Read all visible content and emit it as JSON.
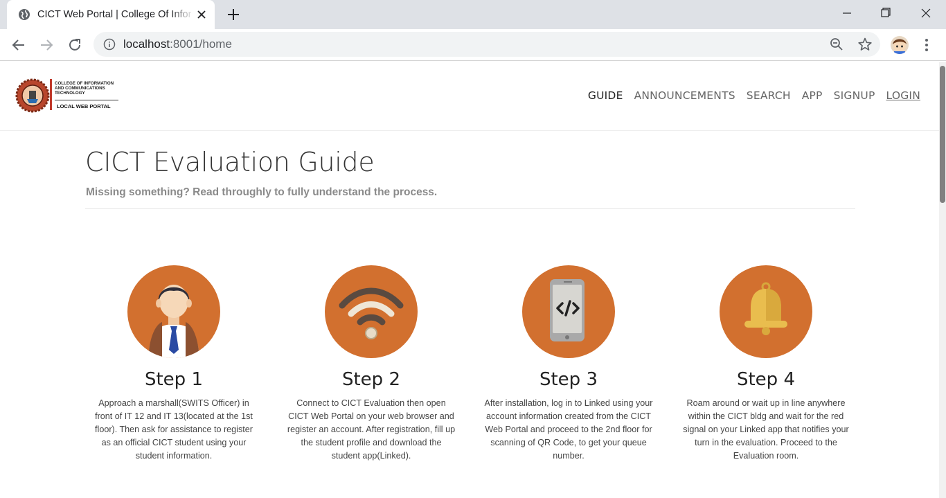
{
  "browser": {
    "tab_title": "CICT Web Portal | College Of Information and Communications Technology",
    "url_host": "localhost",
    "url_rest": ":8001/home"
  },
  "site": {
    "logo": {
      "line1": "COLLEGE OF INFORMATION AND COMMUNICATIONS TECHNOLOGY",
      "line2": "LOCAL WEB PORTAL"
    },
    "nav": [
      "GUIDE",
      "ANNOUNCEMENTS",
      "SEARCH",
      "APP",
      "SIGNUP",
      "LOGIN"
    ]
  },
  "main": {
    "title": "CICT Evaluation Guide",
    "subtitle": "Missing something? Read throughly to fully understand the process.",
    "steps": [
      {
        "title": "Step 1",
        "icon": "student-icon",
        "desc": "Approach a marshall(SWITS Officer) in front of IT 12 and IT 13(located at the 1st floor). Then ask for assistance to register as an official CICT student using your student information."
      },
      {
        "title": "Step 2",
        "icon": "wifi-icon",
        "desc": "Connect to CICT Evaluation then open CICT Web Portal on your web browser and register an account. After registration, fill up the student profile and download the student app(Linked)."
      },
      {
        "title": "Step 3",
        "icon": "phone-code-icon",
        "desc": "After installation, log in to Linked using your account information created from the CICT Web Portal and proceed to the 2nd floor for scanning of QR Code, to get your queue number."
      },
      {
        "title": "Step 4",
        "icon": "bell-icon",
        "desc": "Roam around or wait up in line anywhere within the CICT bldg and wait for the red signal on your Linked app that notifies your turn in the evaluation. Proceed to the Evaluation room."
      }
    ]
  },
  "colors": {
    "accent": "#d2702f",
    "chrome_bg": "#dee1e6"
  }
}
